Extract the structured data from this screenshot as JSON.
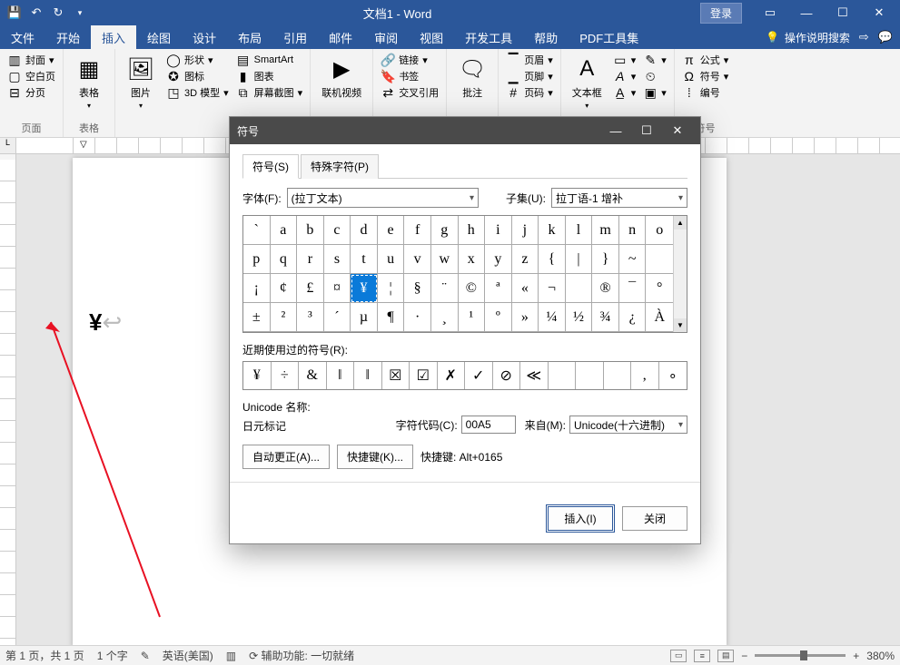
{
  "title": "文档1 - Word",
  "login": "登录",
  "menu": {
    "file": "文件",
    "home": "开始",
    "insert": "插入",
    "draw": "绘图",
    "design": "设计",
    "layout": "布局",
    "ref": "引用",
    "mail": "邮件",
    "review": "审阅",
    "view": "视图",
    "dev": "开发工具",
    "help": "帮助",
    "pdf": "PDF工具集",
    "tell": "操作说明搜索"
  },
  "ribbon": {
    "pages": {
      "cover": "封面",
      "blank": "空白页",
      "break": "分页",
      "label": "页面"
    },
    "tables": {
      "btn": "表格",
      "label": "表格"
    },
    "illus": {
      "pic": "图片",
      "shapes": "形状",
      "icons": "图标",
      "model": "3D 模型",
      "smartart": "SmartArt",
      "chart": "图表",
      "screenshot": "屏幕截图"
    },
    "media": {
      "video": "联机视频"
    },
    "links": {
      "link": "链接",
      "bookmark": "书签",
      "xref": "交叉引用"
    },
    "comment": {
      "btn": "批注"
    },
    "hf": {
      "header": "页眉",
      "footer": "页脚",
      "pagenum": "页码"
    },
    "text": {
      "textbox": "文本框"
    },
    "symbols": {
      "eq": "公式",
      "sym": "符号",
      "num": "编号",
      "label": "符号"
    }
  },
  "doc": {
    "char": "¥",
    "ret": "↩"
  },
  "status": {
    "page": "第 1 页，共 1 页",
    "words": "1 个字",
    "lang": "英语(美国)",
    "acc": "辅助功能: 一切就绪",
    "zoom": "380%"
  },
  "dialog": {
    "title": "符号",
    "tab_symbols": "符号(S)",
    "tab_special": "特殊字符(P)",
    "font_label": "字体(F):",
    "font_value": "(拉丁文本)",
    "subset_label": "子集(U):",
    "subset_value": "拉丁语-1 增补",
    "grid": [
      "`",
      "a",
      "b",
      "c",
      "d",
      "e",
      "f",
      "g",
      "h",
      "i",
      "j",
      "k",
      "l",
      "m",
      "n",
      "o",
      "p",
      "q",
      "r",
      "s",
      "t",
      "u",
      "v",
      "w",
      "x",
      "y",
      "z",
      "{",
      "|",
      "}",
      "~",
      "",
      "¡",
      "¢",
      "£",
      "¤",
      "¥",
      "¦",
      "§",
      "¨",
      "©",
      "ª",
      "«",
      "¬",
      "­",
      "®",
      "¯",
      "°",
      "±",
      "²",
      "³",
      "´",
      "µ",
      "¶",
      "·",
      "¸",
      "¹",
      "º",
      "»",
      "¼",
      "½",
      "¾",
      "¿",
      "À"
    ],
    "selected_index": 36,
    "recent_label": "近期使用过的符号(R):",
    "recent": [
      "¥",
      "÷",
      "&",
      "‖",
      "‖",
      "☒",
      "☑",
      "✗",
      "✓",
      "⊘",
      "≪",
      "",
      "",
      "",
      ",",
      "∘"
    ],
    "unicode_name_label": "Unicode 名称:",
    "unicode_name_value": "日元标记",
    "charcode_label": "字符代码(C):",
    "charcode_value": "00A5",
    "from_label": "来自(M):",
    "from_value": "Unicode(十六进制)",
    "autocorrect": "自动更正(A)...",
    "shortcutkey": "快捷键(K)...",
    "shortcut_text": "快捷键: Alt+0165",
    "insert": "插入(I)",
    "close": "关闭"
  }
}
